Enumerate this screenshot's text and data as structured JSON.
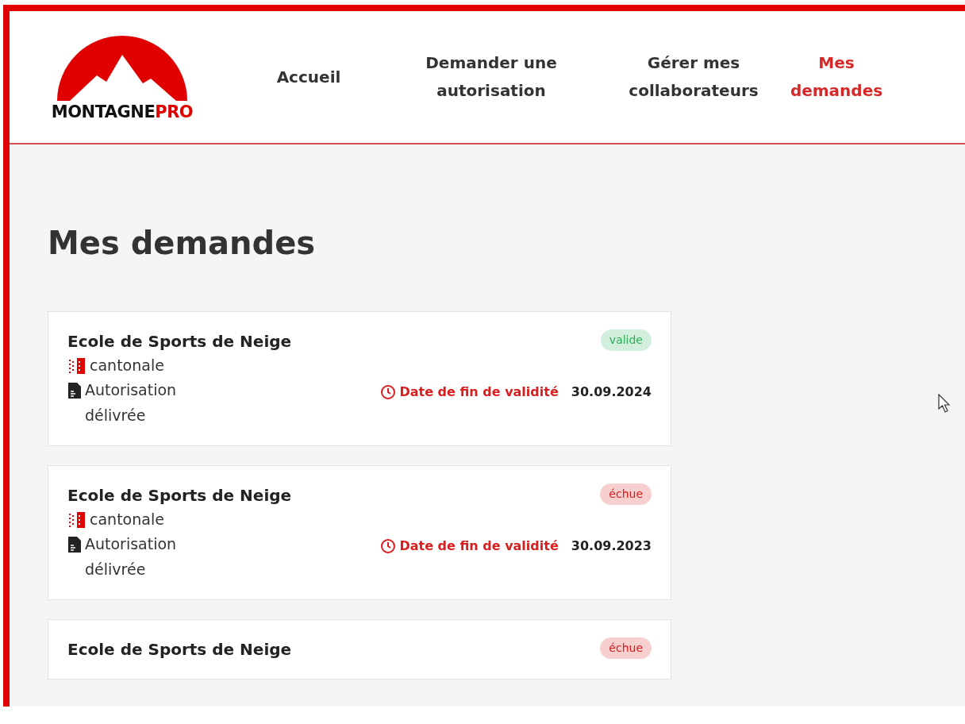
{
  "logo": {
    "text_main": "MONTAGNE",
    "text_accent": "PRO"
  },
  "nav": [
    {
      "label": "Accueil",
      "selected": false
    },
    {
      "label": "Demander une autorisation",
      "selected": false
    },
    {
      "label": "Gérer mes collaborateurs",
      "selected": false
    },
    {
      "label": "Mes demandes",
      "selected": true
    }
  ],
  "page_title": "Mes demandes",
  "requests": [
    {
      "title": "Ecole de Sports de Neige",
      "status": {
        "label": "valide",
        "kind": "valid"
      },
      "scope": "cantonale",
      "document": "Autorisation délivrée",
      "validity_label": "Date de fin de validité",
      "validity_date": "30.09.2024"
    },
    {
      "title": "Ecole de Sports de Neige",
      "status": {
        "label": "échue",
        "kind": "expired"
      },
      "scope": "cantonale",
      "document": "Autorisation délivrée",
      "validity_label": "Date de fin de validité",
      "validity_date": "30.09.2023"
    },
    {
      "title": "Ecole de Sports de Neige",
      "status": {
        "label": "échue",
        "kind": "expired"
      }
    }
  ]
}
